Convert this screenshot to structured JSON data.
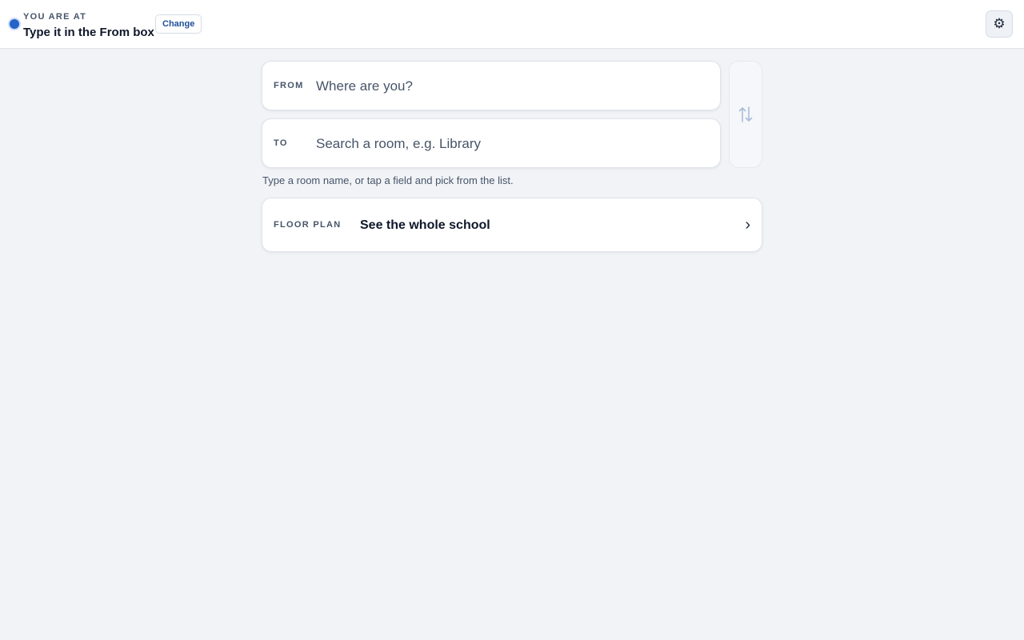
{
  "header": {
    "location_eyebrow": "YOU ARE AT",
    "location_value": "Type it in the From box",
    "change_label": "Change",
    "settings_icon": "gear-icon"
  },
  "route": {
    "from": {
      "label": "FROM",
      "value": "",
      "placeholder": "Where are you?"
    },
    "to": {
      "label": "TO",
      "value": "",
      "placeholder": "Search a room, e.g. Library"
    },
    "swap_icon": "swap-vertical-icon",
    "hint": "Type a room name, or tap a field and pick from the list."
  },
  "floor_plan": {
    "label": "FLOOR PLAN",
    "title": "See the whole school",
    "chevron_icon": "chevron-right-icon"
  },
  "colors": {
    "accent": "#2563c9",
    "page_background": "#f1f3f7",
    "card_background": "#ffffff",
    "muted_text": "#475569",
    "swap_icon_color": "#a9bcd8"
  }
}
